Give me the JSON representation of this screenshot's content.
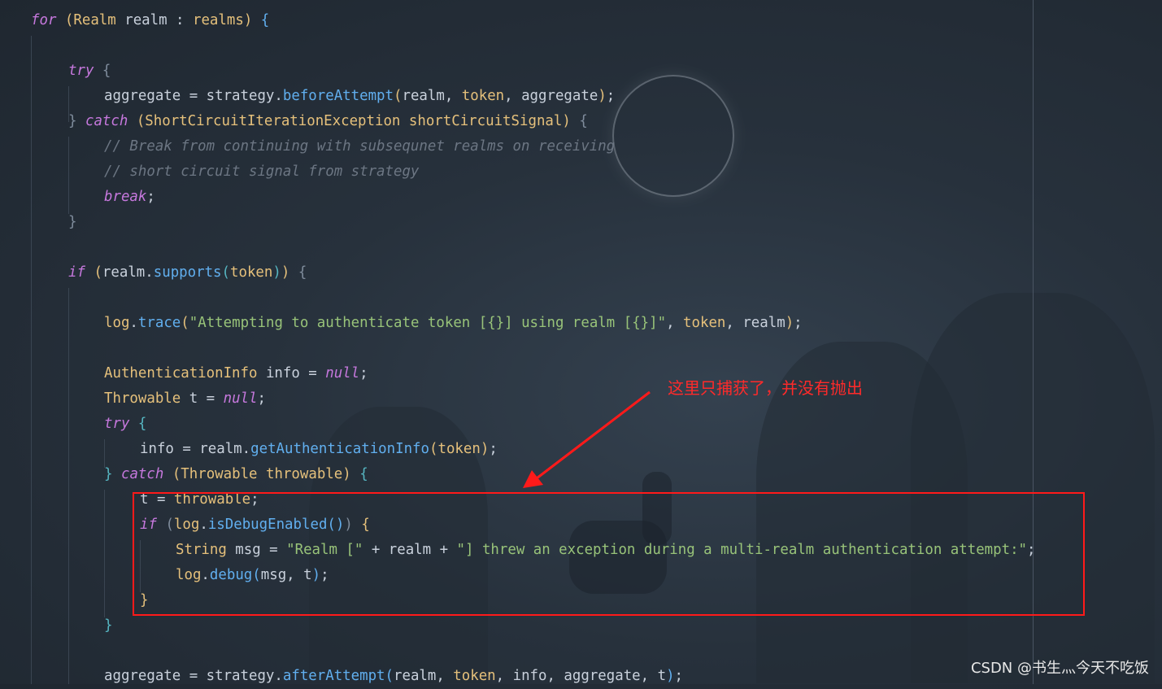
{
  "theme": {
    "background": "#27313c",
    "keyword": "#c678dd",
    "class": "#e5c07b",
    "function": "#61afef",
    "string": "#98c379",
    "comment": "#6c7683",
    "annotation_red": "#ff1a1a"
  },
  "code": [
    [
      {
        "t": "kw",
        "v": "for"
      },
      {
        "t": "pu",
        "v": " "
      },
      {
        "t": "b1",
        "v": "("
      },
      {
        "t": "cls",
        "v": "Realm"
      },
      {
        "t": "var",
        "v": " realm : "
      },
      {
        "t": "param",
        "v": "realms"
      },
      {
        "t": "b1",
        "v": ")"
      },
      {
        "t": "pu",
        "v": " "
      },
      {
        "t": "b3",
        "v": "{"
      }
    ],
    [],
    [
      {
        "t": "kw",
        "v": "try"
      },
      {
        "t": "pu",
        "v": " "
      },
      {
        "t": "b4",
        "v": "{"
      }
    ],
    [
      {
        "t": "var",
        "v": "aggregate = strategy."
      },
      {
        "t": "fn",
        "v": "beforeAttempt"
      },
      {
        "t": "b1",
        "v": "("
      },
      {
        "t": "var",
        "v": "realm, "
      },
      {
        "t": "param",
        "v": "token"
      },
      {
        "t": "var",
        "v": ", aggregate"
      },
      {
        "t": "b1",
        "v": ")"
      },
      {
        "t": "pu",
        "v": ";"
      }
    ],
    [
      {
        "t": "b4",
        "v": "}"
      },
      {
        "t": "pu",
        "v": " "
      },
      {
        "t": "kw",
        "v": "catch"
      },
      {
        "t": "pu",
        "v": " "
      },
      {
        "t": "b1",
        "v": "("
      },
      {
        "t": "cls",
        "v": "ShortCircuitIterationException"
      },
      {
        "t": "pu",
        "v": " "
      },
      {
        "t": "param",
        "v": "shortCircuitSignal"
      },
      {
        "t": "b1",
        "v": ")"
      },
      {
        "t": "pu",
        "v": " "
      },
      {
        "t": "b4",
        "v": "{"
      }
    ],
    [
      {
        "t": "cm",
        "v": "// Break from continuing with subsequnet realms on receiving"
      }
    ],
    [
      {
        "t": "cm",
        "v": "// short circuit signal from strategy"
      }
    ],
    [
      {
        "t": "kw",
        "v": "break"
      },
      {
        "t": "pu",
        "v": ";"
      }
    ],
    [
      {
        "t": "b4",
        "v": "}"
      }
    ],
    [],
    [
      {
        "t": "kw",
        "v": "if"
      },
      {
        "t": "pu",
        "v": " "
      },
      {
        "t": "b1",
        "v": "("
      },
      {
        "t": "var",
        "v": "realm."
      },
      {
        "t": "fn",
        "v": "supports"
      },
      {
        "t": "b2",
        "v": "("
      },
      {
        "t": "param",
        "v": "token"
      },
      {
        "t": "b2",
        "v": ")"
      },
      {
        "t": "b1",
        "v": ")"
      },
      {
        "t": "pu",
        "v": " "
      },
      {
        "t": "b4",
        "v": "{"
      }
    ],
    [],
    [
      {
        "t": "param",
        "v": "log"
      },
      {
        "t": "var",
        "v": "."
      },
      {
        "t": "fn",
        "v": "trace"
      },
      {
        "t": "b1",
        "v": "("
      },
      {
        "t": "str",
        "v": "\"Attempting to authenticate token [{}] using realm [{}]\""
      },
      {
        "t": "var",
        "v": ", "
      },
      {
        "t": "param",
        "v": "token"
      },
      {
        "t": "var",
        "v": ", realm"
      },
      {
        "t": "b1",
        "v": ")"
      },
      {
        "t": "pu",
        "v": ";"
      }
    ],
    [],
    [
      {
        "t": "cls",
        "v": "AuthenticationInfo"
      },
      {
        "t": "var",
        "v": " info = "
      },
      {
        "t": "kw",
        "v": "null"
      },
      {
        "t": "pu",
        "v": ";"
      }
    ],
    [
      {
        "t": "cls",
        "v": "Throwable"
      },
      {
        "t": "var",
        "v": " t = "
      },
      {
        "t": "kw",
        "v": "null"
      },
      {
        "t": "pu",
        "v": ";"
      }
    ],
    [
      {
        "t": "kw",
        "v": "try"
      },
      {
        "t": "pu",
        "v": " "
      },
      {
        "t": "b2",
        "v": "{"
      }
    ],
    [
      {
        "t": "var",
        "v": "info = realm."
      },
      {
        "t": "fn",
        "v": "getAuthenticationInfo"
      },
      {
        "t": "b1",
        "v": "("
      },
      {
        "t": "param",
        "v": "token"
      },
      {
        "t": "b1",
        "v": ")"
      },
      {
        "t": "pu",
        "v": ";"
      }
    ],
    [
      {
        "t": "b2",
        "v": "}"
      },
      {
        "t": "pu",
        "v": " "
      },
      {
        "t": "kw",
        "v": "catch"
      },
      {
        "t": "pu",
        "v": " "
      },
      {
        "t": "b1",
        "v": "("
      },
      {
        "t": "cls",
        "v": "Throwable"
      },
      {
        "t": "pu",
        "v": " "
      },
      {
        "t": "param",
        "v": "throwable"
      },
      {
        "t": "b1",
        "v": ")"
      },
      {
        "t": "pu",
        "v": " "
      },
      {
        "t": "b2",
        "v": "{"
      }
    ],
    [
      {
        "t": "var",
        "v": "t = "
      },
      {
        "t": "param",
        "v": "throwable"
      },
      {
        "t": "pu",
        "v": ";"
      }
    ],
    [
      {
        "t": "kw",
        "v": "if"
      },
      {
        "t": "pu",
        "v": " "
      },
      {
        "t": "b4",
        "v": "("
      },
      {
        "t": "param",
        "v": "log"
      },
      {
        "t": "var",
        "v": "."
      },
      {
        "t": "fn",
        "v": "isDebugEnabled"
      },
      {
        "t": "b3",
        "v": "()"
      },
      {
        "t": "b4",
        "v": ")"
      },
      {
        "t": "pu",
        "v": " "
      },
      {
        "t": "b1",
        "v": "{"
      }
    ],
    [
      {
        "t": "cls",
        "v": "String"
      },
      {
        "t": "var",
        "v": " msg = "
      },
      {
        "t": "str",
        "v": "\"Realm [\""
      },
      {
        "t": "var",
        "v": " + realm + "
      },
      {
        "t": "str",
        "v": "\"] threw an exception during a multi-realm authentication attempt:\""
      },
      {
        "t": "pu",
        "v": ";"
      }
    ],
    [
      {
        "t": "param",
        "v": "log"
      },
      {
        "t": "var",
        "v": "."
      },
      {
        "t": "fn",
        "v": "debug"
      },
      {
        "t": "b3",
        "v": "("
      },
      {
        "t": "var",
        "v": "msg, t"
      },
      {
        "t": "b3",
        "v": ")"
      },
      {
        "t": "pu",
        "v": ";"
      }
    ],
    [
      {
        "t": "b1",
        "v": "}"
      }
    ],
    [
      {
        "t": "b2",
        "v": "}"
      }
    ],
    [],
    [
      {
        "t": "var",
        "v": "aggregate = strategy."
      },
      {
        "t": "fn",
        "v": "afterAttempt"
      },
      {
        "t": "b3",
        "v": "("
      },
      {
        "t": "var",
        "v": "realm, "
      },
      {
        "t": "param",
        "v": "token"
      },
      {
        "t": "var",
        "v": ", info, aggregate, t"
      },
      {
        "t": "b3",
        "v": ")"
      },
      {
        "t": "pu",
        "v": ";"
      }
    ]
  ],
  "annotation": {
    "text": "这里只捕获了，并没有抛出"
  },
  "watermark": {
    "text": "CSDN @书生灬今天不吃饭"
  }
}
